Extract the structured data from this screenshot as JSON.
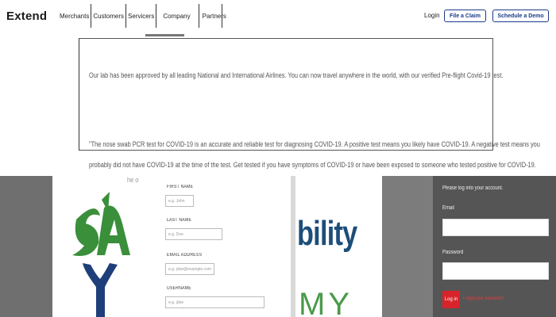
{
  "nav": {
    "logo": "Extend",
    "links": [
      "Merchants",
      "Customers",
      "Servicers",
      "Company",
      "Partners"
    ],
    "active_link": "Company",
    "login": "Login",
    "file_claim": "File a Claim",
    "schedule_demo": "Schedule a Demo"
  },
  "panel": {
    "paragraph1": "Our lab has been approved by all leading National and International Airlines. You can now travel anywhere in the world, with our verified Pre-flight Covid-19 test.",
    "paragraph2_line1": "\"The nose swab PCR test for COVID-19 is an accurate and reliable test for diagnosing COVID-19. A positive test means you likely have COVID-19. A negative test means you",
    "paragraph2_line2": "probably did not have COVID-19 at the time of the test. Get tested if you have symptoms of COVID-19 or have been exposed to someone who tested positive for COVID-19.",
    "partial_line": "he                                                                                                          ority"
  },
  "signup_form": {
    "first_name_label": "FIRST NAME",
    "first_name_placeholder": "e.g. John",
    "last_name_label": "LAST NAME",
    "last_name_placeholder": "e.g. Doe",
    "email_label": "EMAIL ADDRESS",
    "email_placeholder": "e.g. jdoe@example.com",
    "username_label": "USERNAME",
    "username_placeholder": "e.g. jdoe"
  },
  "logos": {
    "left_text": "s/a",
    "right_text": "bility",
    "right_sub": "MY"
  },
  "login_panel": {
    "prompt": "Please log into your account.",
    "email_label": "Email",
    "password_label": "Password",
    "login_button": "Log in",
    "forgot_link": "Forgot your password?"
  },
  "colors": {
    "brand_blue": "#1a3a8a",
    "login_red": "#d9232a",
    "logo_green": "#3a8f3a",
    "logo_navy": "#1d4e7a"
  }
}
